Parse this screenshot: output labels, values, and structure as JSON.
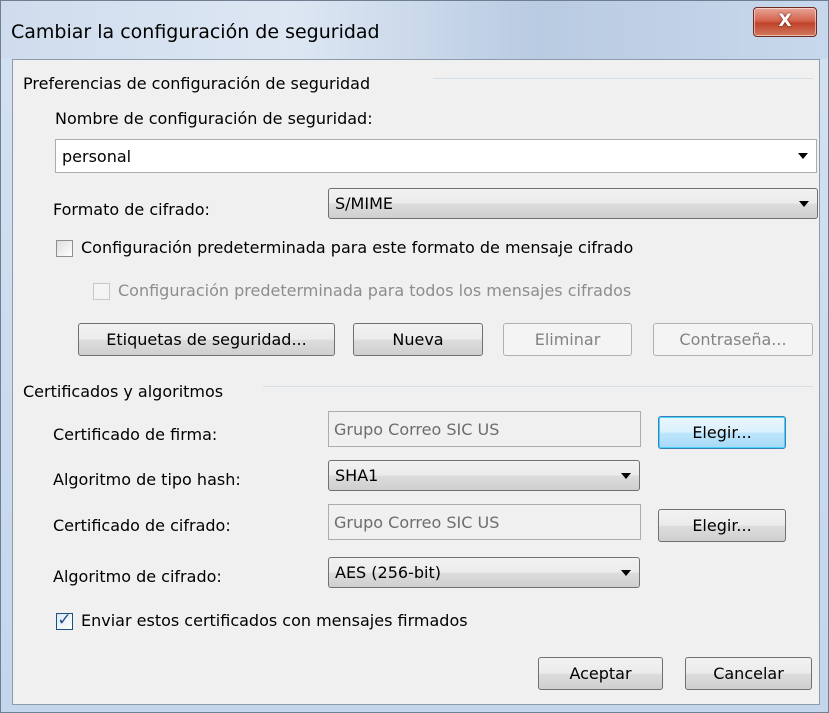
{
  "window": {
    "title": "Cambiar la configuración de seguridad",
    "close_label": "X"
  },
  "security_prefs": {
    "group_label": "Preferencias de configuración de seguridad",
    "name_label": "Nombre de configuración de seguridad:",
    "name_value": "personal",
    "format_label": "Formato de cifrado:",
    "format_value": "S/MIME",
    "default_format_checkbox": {
      "label": "Configuración predeterminada para este formato de mensaje cifrado",
      "checked": false
    },
    "default_all_checkbox": {
      "label": "Configuración predeterminada para todos los mensajes cifrados",
      "checked": false,
      "enabled": false
    },
    "buttons": {
      "security_labels": "Etiquetas de seguridad...",
      "new": "Nueva",
      "delete": "Eliminar",
      "password": "Contraseña..."
    }
  },
  "certs": {
    "group_label": "Certificados y algoritmos",
    "signing_cert_label": "Certificado de firma:",
    "signing_cert_value": "Grupo Correo SIC US",
    "choose_signing": "Elegir...",
    "hash_label": "Algoritmo de tipo hash:",
    "hash_value": "SHA1",
    "encryption_cert_label": "Certificado de cifrado:",
    "encryption_cert_value": "Grupo Correo SIC US",
    "choose_encryption": "Elegir...",
    "encryption_algo_label": "Algoritmo de cifrado:",
    "encryption_algo_value": "AES (256-bit)",
    "send_certs_checkbox": {
      "label": "Enviar estos certificados con mensajes firmados",
      "checked": true
    }
  },
  "footer": {
    "ok": "Aceptar",
    "cancel": "Cancelar"
  }
}
